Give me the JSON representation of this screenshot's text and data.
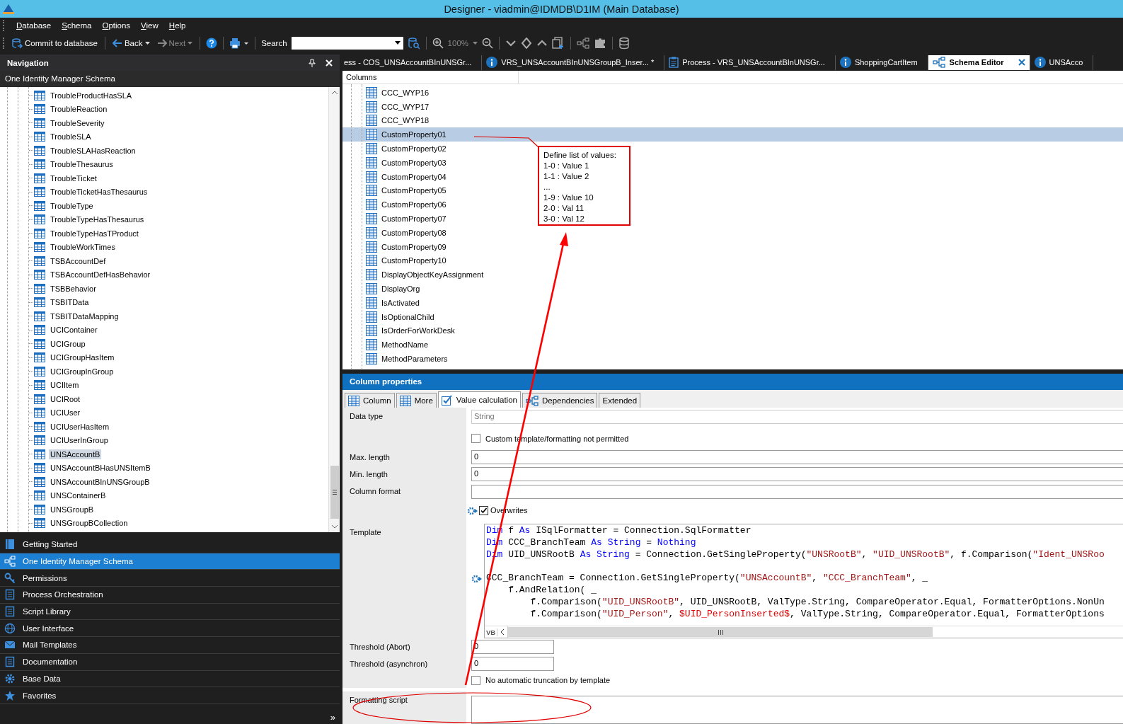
{
  "window": {
    "title": "Designer - viadmin@IDMDB\\D1IM (Main Database)"
  },
  "menu": [
    "Database",
    "Schema",
    "Options",
    "View",
    "Help"
  ],
  "toolbar": {
    "commit": "Commit to database",
    "back": "Back",
    "next": {
      "label": "Next",
      "disabled": true
    },
    "search_label": "Search",
    "zoom": {
      "label": "100%",
      "disabled": true
    }
  },
  "navigation": {
    "title": "Navigation",
    "section": "One Identity Manager Schema",
    "tree": [
      {
        "label": "TroubleProductHasSLA",
        "selected": false
      },
      {
        "label": "TroubleReaction",
        "selected": false
      },
      {
        "label": "TroubleSeverity",
        "selected": false
      },
      {
        "label": "TroubleSLA",
        "selected": false
      },
      {
        "label": "TroubleSLAHasReaction",
        "selected": false
      },
      {
        "label": "TroubleThesaurus",
        "selected": false
      },
      {
        "label": "TroubleTicket",
        "selected": false
      },
      {
        "label": "TroubleTicketHasThesaurus",
        "selected": false
      },
      {
        "label": "TroubleType",
        "selected": false
      },
      {
        "label": "TroubleTypeHasThesaurus",
        "selected": false
      },
      {
        "label": "TroubleTypeHasTProduct",
        "selected": false
      },
      {
        "label": "TroubleWorkTimes",
        "selected": false
      },
      {
        "label": "TSBAccountDef",
        "selected": false
      },
      {
        "label": "TSBAccountDefHasBehavior",
        "selected": false
      },
      {
        "label": "TSBBehavior",
        "selected": false
      },
      {
        "label": "TSBITData",
        "selected": false
      },
      {
        "label": "TSBITDataMapping",
        "selected": false
      },
      {
        "label": "UCIContainer",
        "selected": false
      },
      {
        "label": "UCIGroup",
        "selected": false
      },
      {
        "label": "UCIGroupHasItem",
        "selected": false
      },
      {
        "label": "UCIGroupInGroup",
        "selected": false
      },
      {
        "label": "UCIItem",
        "selected": false
      },
      {
        "label": "UCIRoot",
        "selected": false
      },
      {
        "label": "UCIUser",
        "selected": false
      },
      {
        "label": "UCIUserHasItem",
        "selected": false
      },
      {
        "label": "UCIUserInGroup",
        "selected": false
      },
      {
        "label": "UNSAccountB",
        "selected": true
      },
      {
        "label": "UNSAccountBHasUNSItemB",
        "selected": false
      },
      {
        "label": "UNSAccountBInUNSGroupB",
        "selected": false
      },
      {
        "label": "UNSContainerB",
        "selected": false
      },
      {
        "label": "UNSGroupB",
        "selected": false
      },
      {
        "label": "UNSGroupBCollection",
        "selected": false
      }
    ],
    "items": [
      {
        "label": "Getting Started",
        "selected": false
      },
      {
        "label": "One Identity Manager Schema",
        "selected": true
      },
      {
        "label": "Permissions",
        "selected": false
      },
      {
        "label": "Process Orchestration",
        "selected": false
      },
      {
        "label": "Script Library",
        "selected": false
      },
      {
        "label": "User Interface",
        "selected": false
      },
      {
        "label": "Mail Templates",
        "selected": false
      },
      {
        "label": "Documentation",
        "selected": false
      },
      {
        "label": "Base Data",
        "selected": false
      },
      {
        "label": "Favorites",
        "selected": false
      }
    ],
    "more": "»"
  },
  "document_tabs": [
    {
      "label": "ess - COS_UNSAccountBInUNSGr...",
      "kind": "plain",
      "selected": false
    },
    {
      "label": "VRS_UNSAccountBInUNSGroupB_Inser... *",
      "kind": "info",
      "selected": false
    },
    {
      "label": "Process - VRS_UNSAccountBInUNSGr...",
      "kind": "process",
      "selected": false
    },
    {
      "label": "ShoppingCartItem",
      "kind": "info",
      "selected": false
    },
    {
      "label": "Schema Editor",
      "kind": "schema",
      "selected": true
    },
    {
      "label": "UNSAcco",
      "kind": "info",
      "selected": false
    }
  ],
  "columns_panel": {
    "header": "Columns",
    "columns": [
      {
        "label": "CCC_WYP16",
        "selected": false
      },
      {
        "label": "CCC_WYP17",
        "selected": false
      },
      {
        "label": "CCC_WYP18",
        "selected": false
      },
      {
        "label": "CustomProperty01",
        "selected": true
      },
      {
        "label": "CustomProperty02",
        "selected": false
      },
      {
        "label": "CustomProperty03",
        "selected": false
      },
      {
        "label": "CustomProperty04",
        "selected": false
      },
      {
        "label": "CustomProperty05",
        "selected": false
      },
      {
        "label": "CustomProperty06",
        "selected": false
      },
      {
        "label": "CustomProperty07",
        "selected": false
      },
      {
        "label": "CustomProperty08",
        "selected": false
      },
      {
        "label": "CustomProperty09",
        "selected": false
      },
      {
        "label": "CustomProperty10",
        "selected": false
      },
      {
        "label": "DisplayObjectKeyAssignment",
        "selected": false
      },
      {
        "label": "DisplayOrg",
        "selected": false
      },
      {
        "label": "IsActivated",
        "selected": false
      },
      {
        "label": "IsOptionalChild",
        "selected": false
      },
      {
        "label": "IsOrderForWorkDesk",
        "selected": false
      },
      {
        "label": "MethodName",
        "selected": false
      },
      {
        "label": "MethodParameters",
        "selected": false
      }
    ]
  },
  "column_properties": {
    "title": "Column properties",
    "tabs": [
      {
        "label": "Column",
        "kind": "table",
        "selected": false
      },
      {
        "label": "More",
        "kind": "table",
        "selected": false
      },
      {
        "label": "Value calculation",
        "kind": "calc",
        "selected": true
      },
      {
        "label": "Dependencies",
        "kind": "diagram",
        "selected": false
      },
      {
        "label": "Extended",
        "kind": "plain",
        "selected": false
      }
    ],
    "data_type": {
      "label": "Data type",
      "value": "String",
      "disabled": true
    },
    "custom_template": {
      "label": "Custom template/formatting not permitted",
      "checked": false
    },
    "max_length": {
      "label": "Max. length",
      "value": "0"
    },
    "min_length": {
      "label": "Min. length",
      "value": "0"
    },
    "column_format": {
      "label": "Column format"
    },
    "overwrites": {
      "label": "Overwrites",
      "checked": true
    },
    "template": {
      "label": "Template",
      "language": "VB",
      "lines": [
        {
          "tokens": [
            {
              "kind": "keyword",
              "text": "Dim"
            },
            {
              "kind": "plain",
              "text": " f "
            },
            {
              "kind": "keyword",
              "text": "As"
            },
            {
              "kind": "plain",
              "text": " ISqlFormatter = Connection.SqlFormatter"
            }
          ]
        },
        {
          "tokens": [
            {
              "kind": "keyword",
              "text": "Dim"
            },
            {
              "kind": "plain",
              "text": " CCC_BranchTeam "
            },
            {
              "kind": "keyword",
              "text": "As"
            },
            {
              "kind": "keyword",
              "text": " String"
            },
            {
              "kind": "plain",
              "text": " = "
            },
            {
              "kind": "keyword",
              "text": "Nothing"
            }
          ]
        },
        {
          "tokens": [
            {
              "kind": "keyword",
              "text": "Dim"
            },
            {
              "kind": "plain",
              "text": " UID_UNSRootB "
            },
            {
              "kind": "keyword",
              "text": "As"
            },
            {
              "kind": "keyword",
              "text": " String"
            },
            {
              "kind": "plain",
              "text": " = Connection.GetSingleProperty("
            },
            {
              "kind": "string",
              "text": "\"UNSRootB\""
            },
            {
              "kind": "plain",
              "text": ", "
            },
            {
              "kind": "string",
              "text": "\"UID_UNSRootB\""
            },
            {
              "kind": "plain",
              "text": ", f.Comparison("
            },
            {
              "kind": "string",
              "text": "\"Ident_UNSRoo"
            }
          ]
        },
        {
          "blank_before": true,
          "tokens": [
            {
              "kind": "plain",
              "text": "CCC_BranchTeam = Connection.GetSingleProperty("
            },
            {
              "kind": "string",
              "text": "\"UNSAccountB\""
            },
            {
              "kind": "plain",
              "text": ", "
            },
            {
              "kind": "string",
              "text": "\"CCC_BranchTeam\""
            },
            {
              "kind": "plain",
              "text": ", _"
            }
          ]
        },
        {
          "tokens": [
            {
              "kind": "plain",
              "text": "    f.AndRelation( _"
            }
          ]
        },
        {
          "tokens": [
            {
              "kind": "plain",
              "text": "        f.Comparison("
            },
            {
              "kind": "string",
              "text": "\"UID_UNSRootB\""
            },
            {
              "kind": "plain",
              "text": ", UID_UNSRootB, ValType.String, CompareOperator.Equal, FormatterOptions.NonUn"
            }
          ]
        },
        {
          "tokens": [
            {
              "kind": "plain",
              "text": "        f.Comparison("
            },
            {
              "kind": "string",
              "text": "\"UID_Person\""
            },
            {
              "kind": "plain",
              "text": ", "
            },
            {
              "kind": "variable",
              "text": "$UID_PersonInserted$"
            },
            {
              "kind": "plain",
              "text": ", ValType.String, CompareOperator.Equal, FormatterOptions"
            }
          ]
        }
      ]
    },
    "threshold_abort": {
      "label": "Threshold (Abort)",
      "value": "0"
    },
    "threshold_async": {
      "label": "Threshold (asynchron)",
      "value": "0"
    },
    "no_truncation": {
      "label": "No automatic truncation by template",
      "checked": false
    },
    "formatting_script": {
      "label": "Formatting script"
    }
  },
  "annotation": {
    "lines": [
      "Define list of values:",
      "1-0 : Value 1",
      "1-1 : Value 2",
      "...",
      "1-9 : Value 10",
      "2-0 : Val 11",
      "3-0 :  Val 12"
    ]
  }
}
